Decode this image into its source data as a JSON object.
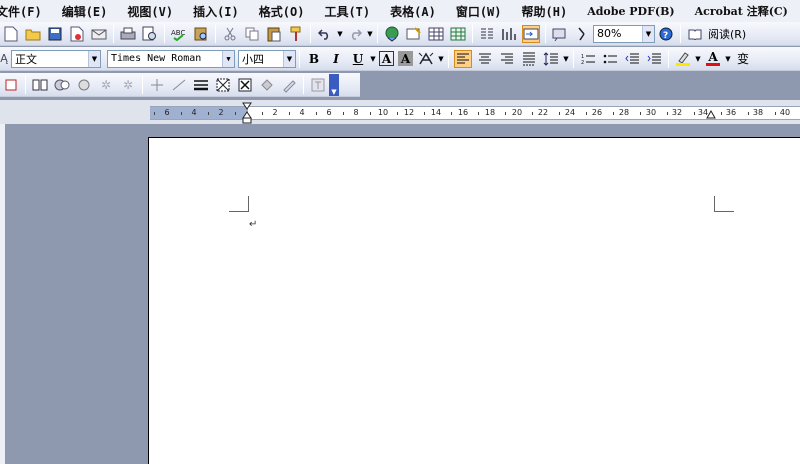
{
  "menu": [
    "文件(F)",
    "编辑(E)",
    "视图(V)",
    "插入(I)",
    "格式(O)",
    "工具(T)",
    "表格(A)",
    "窗口(W)",
    "帮助(H)",
    "Adobe PDF(B)",
    "Acrobat 注释(C)"
  ],
  "toolbar_standard": {
    "zoom_value": "80%",
    "read_label": "阅读(R)"
  },
  "toolbar_formatting": {
    "style_value": "正文",
    "font_value": "Times New Roman",
    "size_value": "小四",
    "bold_label": "B",
    "italic_label": "I",
    "underline_label": "U",
    "char_border_label": "A",
    "char_shade_label": "A",
    "font_color_label": "A",
    "phonetic_label": "变"
  },
  "ruler": {
    "left_labels": [
      "6",
      "4",
      "2"
    ],
    "right_labels": [
      "2",
      "4",
      "6",
      "8",
      "10",
      "12",
      "14",
      "16",
      "18",
      "20",
      "22",
      "24",
      "26",
      "28",
      "30",
      "32",
      "34",
      "36",
      "38",
      "40"
    ]
  },
  "document": {
    "paragraph_mark": "↵"
  },
  "colors": {
    "background": "#8e99b0",
    "toolbar_gradient_top": "#f8f9fd",
    "toolbar_gradient_bottom": "#d7ddec",
    "active_button": "#ffcf86"
  }
}
